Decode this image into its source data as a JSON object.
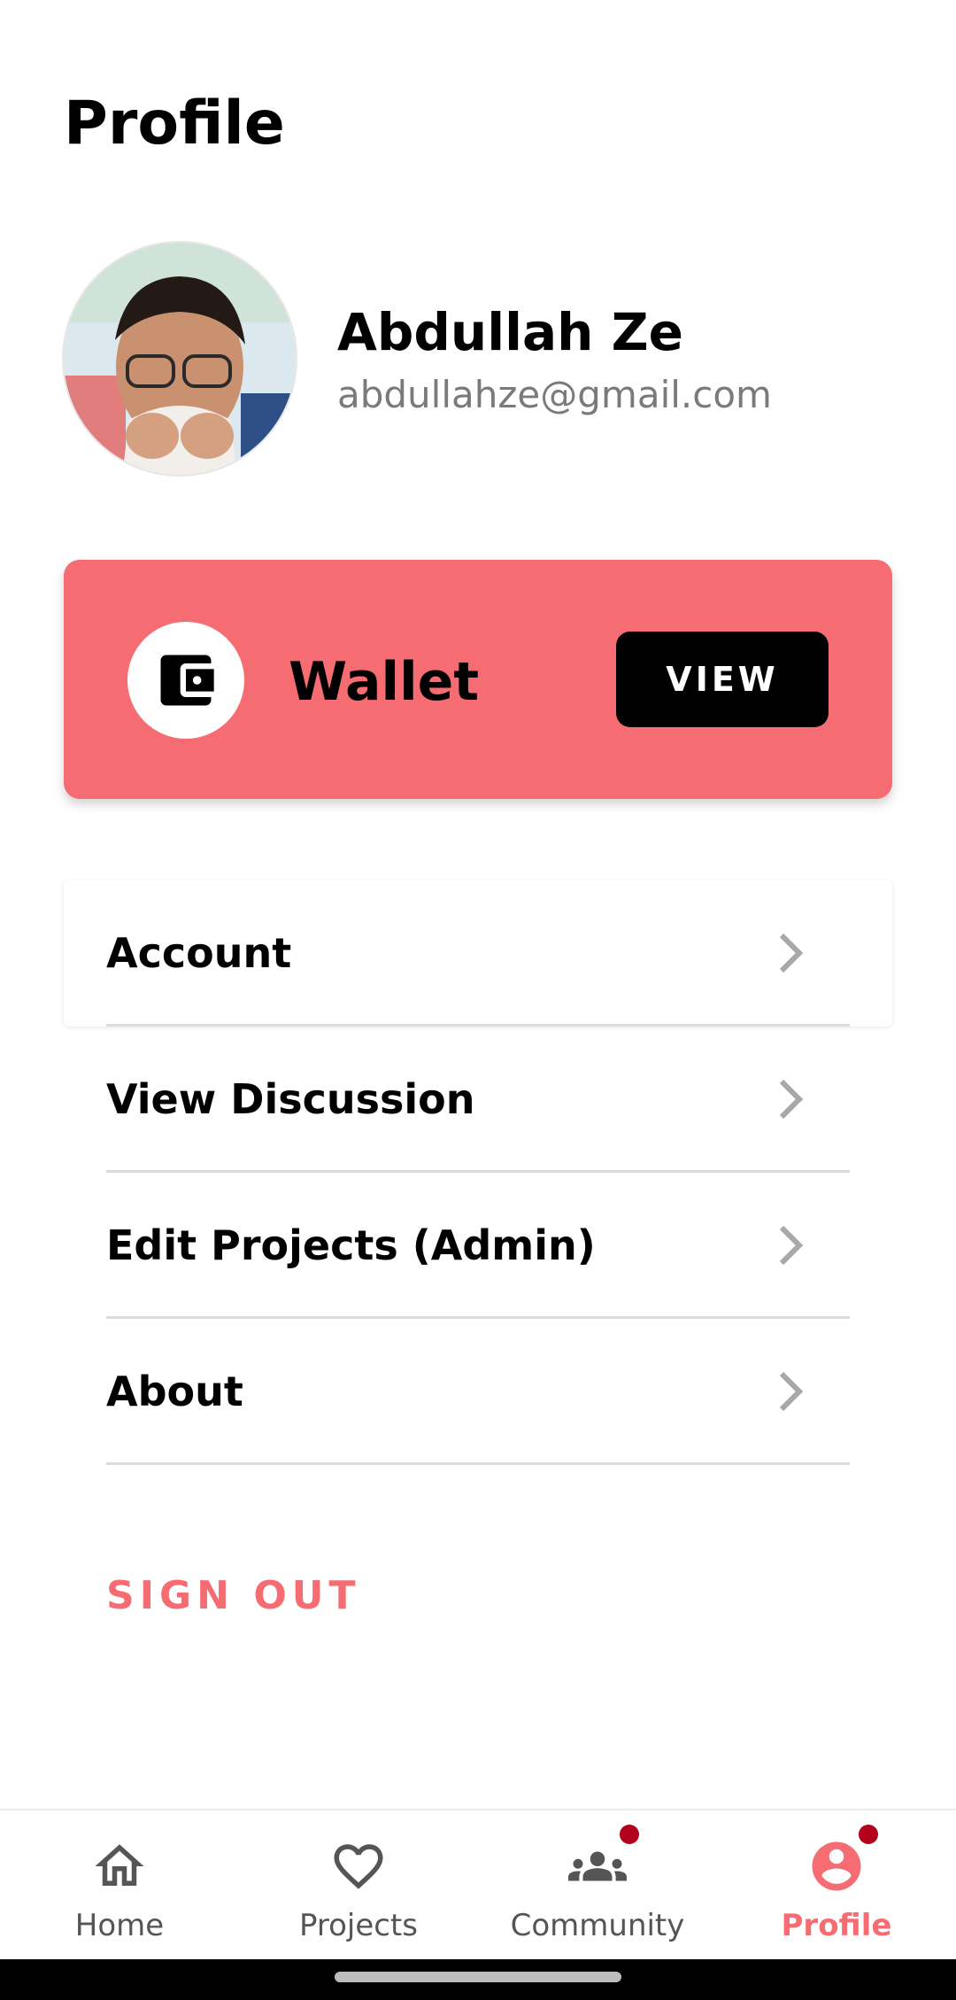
{
  "header": {
    "title": "Profile"
  },
  "user": {
    "name": "Abdullah Ze",
    "email": "abdullahze@gmail.com"
  },
  "wallet": {
    "label": "Wallet",
    "button_label": "VIEW",
    "icon": "wallet-icon"
  },
  "menu": {
    "items": [
      {
        "label": "Account",
        "icon": "chevron-right-icon"
      },
      {
        "label": "View Discussion",
        "icon": "chevron-right-icon"
      },
      {
        "label": "Edit Projects (Admin)",
        "icon": "chevron-right-icon"
      },
      {
        "label": "About",
        "icon": "chevron-right-icon"
      }
    ]
  },
  "sign_out": {
    "label": "SIGN OUT"
  },
  "bottom_nav": {
    "items": [
      {
        "label": "Home",
        "icon": "home-icon",
        "active": false,
        "badge": false
      },
      {
        "label": "Projects",
        "icon": "heart-icon",
        "active": false,
        "badge": false
      },
      {
        "label": "Community",
        "icon": "people-icon",
        "active": false,
        "badge": true
      },
      {
        "label": "Profile",
        "icon": "account-circle-icon",
        "active": true,
        "badge": true
      }
    ]
  },
  "colors": {
    "accent": "#f56d72",
    "badge": "#b3001b",
    "text_secondary": "#7a7a7a"
  }
}
